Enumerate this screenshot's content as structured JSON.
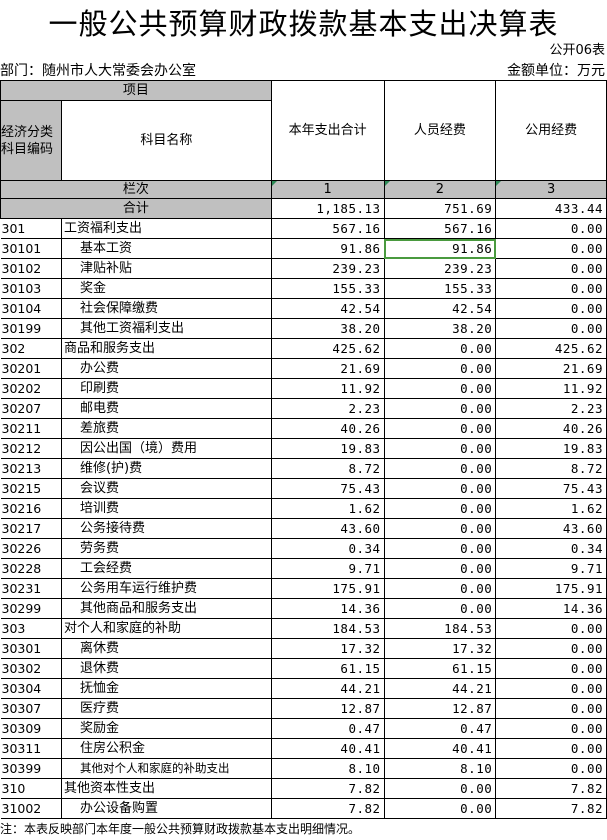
{
  "title": "一般公共预算财政拨款基本支出决算表",
  "form_no": "公开06表",
  "department": "部门：随州市人大常委会办公室",
  "unit": "金额单位：万元",
  "headers": {
    "item": "项目",
    "econ_code_line1": "经济分类",
    "econ_code_line2": "科目编码",
    "subject_name": "科目名称",
    "total": "本年支出合计",
    "personnel": "人员经费",
    "public": "公用经费",
    "column_label": "栏次",
    "col1": "1",
    "col2": "2",
    "col3": "3"
  },
  "total_row": {
    "label": "合计",
    "total": "1,185.13",
    "personnel": "751.69",
    "public": "433.44"
  },
  "rows": [
    {
      "code": "301",
      "name": "工资福利支出",
      "total": "567.16",
      "personnel": "567.16",
      "public": "0.00"
    },
    {
      "code": "30101",
      "name": "基本工资",
      "total": "91.86",
      "personnel": "91.86",
      "public": "0.00"
    },
    {
      "code": "30102",
      "name": "津贴补贴",
      "total": "239.23",
      "personnel": "239.23",
      "public": "0.00"
    },
    {
      "code": "30103",
      "name": "奖金",
      "total": "155.33",
      "personnel": "155.33",
      "public": "0.00"
    },
    {
      "code": "30104",
      "name": "社会保障缴费",
      "total": "42.54",
      "personnel": "42.54",
      "public": "0.00"
    },
    {
      "code": "30199",
      "name": "其他工资福利支出",
      "total": "38.20",
      "personnel": "38.20",
      "public": "0.00"
    },
    {
      "code": "302",
      "name": "商品和服务支出",
      "total": "425.62",
      "personnel": "0.00",
      "public": "425.62"
    },
    {
      "code": "30201",
      "name": "办公费",
      "total": "21.69",
      "personnel": "0.00",
      "public": "21.69"
    },
    {
      "code": "30202",
      "name": "印刷费",
      "total": "11.92",
      "personnel": "0.00",
      "public": "11.92"
    },
    {
      "code": "30207",
      "name": "邮电费",
      "total": "2.23",
      "personnel": "0.00",
      "public": "2.23"
    },
    {
      "code": "30211",
      "name": "差旅费",
      "total": "40.26",
      "personnel": "0.00",
      "public": "40.26"
    },
    {
      "code": "30212",
      "name": "因公出国（境）费用",
      "total": "19.83",
      "personnel": "0.00",
      "public": "19.83"
    },
    {
      "code": "30213",
      "name": "维修(护)费",
      "total": "8.72",
      "personnel": "0.00",
      "public": "8.72"
    },
    {
      "code": "30215",
      "name": "会议费",
      "total": "75.43",
      "personnel": "0.00",
      "public": "75.43"
    },
    {
      "code": "30216",
      "name": "培训费",
      "total": "1.62",
      "personnel": "0.00",
      "public": "1.62"
    },
    {
      "code": "30217",
      "name": "公务接待费",
      "total": "43.60",
      "personnel": "0.00",
      "public": "43.60"
    },
    {
      "code": "30226",
      "name": "劳务费",
      "total": "0.34",
      "personnel": "0.00",
      "public": "0.34"
    },
    {
      "code": "30228",
      "name": "工会经费",
      "total": "9.71",
      "personnel": "0.00",
      "public": "9.71"
    },
    {
      "code": "30231",
      "name": "公务用车运行维护费",
      "total": "175.91",
      "personnel": "0.00",
      "public": "175.91"
    },
    {
      "code": "30299",
      "name": "其他商品和服务支出",
      "total": "14.36",
      "personnel": "0.00",
      "public": "14.36"
    },
    {
      "code": "303",
      "name": "对个人和家庭的补助",
      "total": "184.53",
      "personnel": "184.53",
      "public": "0.00"
    },
    {
      "code": "30301",
      "name": "离休费",
      "total": "17.32",
      "personnel": "17.32",
      "public": "0.00"
    },
    {
      "code": "30302",
      "name": "退休费",
      "total": "61.15",
      "personnel": "61.15",
      "public": "0.00"
    },
    {
      "code": "30304",
      "name": "抚恤金",
      "total": "44.21",
      "personnel": "44.21",
      "public": "0.00"
    },
    {
      "code": "30307",
      "name": "医疗费",
      "total": "12.87",
      "personnel": "12.87",
      "public": "0.00"
    },
    {
      "code": "30309",
      "name": "奖励金",
      "total": "0.47",
      "personnel": "0.47",
      "public": "0.00"
    },
    {
      "code": "30311",
      "name": "住房公积金",
      "total": "40.41",
      "personnel": "40.41",
      "public": "0.00"
    },
    {
      "code": "30399",
      "name": "其他对个人和家庭的补助支出",
      "total": "8.10",
      "personnel": "8.10",
      "public": "0.00"
    },
    {
      "code": "310",
      "name": "其他资本性支出",
      "total": "7.82",
      "personnel": "0.00",
      "public": "7.82"
    },
    {
      "code": "31002",
      "name": "办公设备购置",
      "total": "7.82",
      "personnel": "0.00",
      "public": "7.82"
    }
  ],
  "note": "注：本表反映部门本年度一般公共预算财政拨款基本支出明细情况。"
}
